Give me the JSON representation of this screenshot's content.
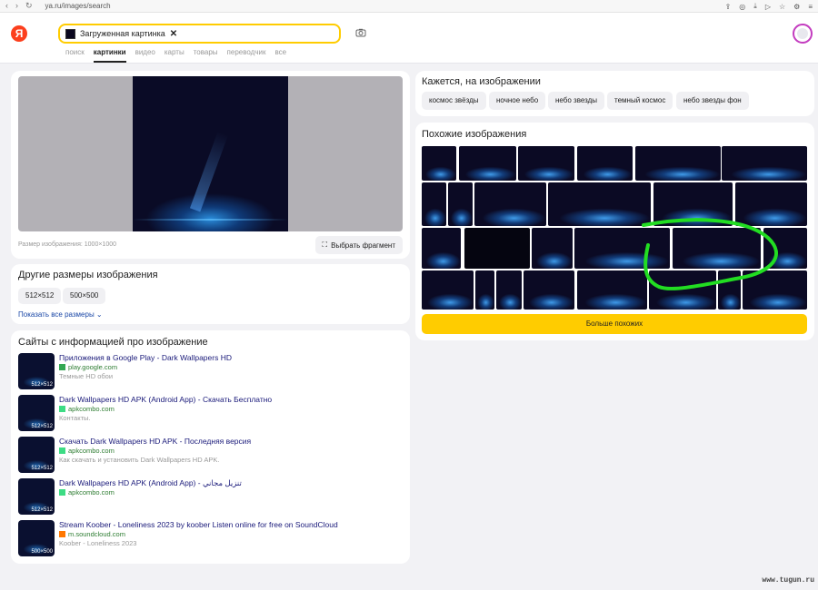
{
  "browser": {
    "url": "ya.ru/images/search"
  },
  "header": {
    "logo": "Я",
    "search_chip": "Загруженная картинка",
    "chip_close": "✕",
    "tabs": [
      "поиск",
      "картинки",
      "видео",
      "карты",
      "товары",
      "переводчик",
      "все"
    ],
    "active_tab": "картинки"
  },
  "preview": {
    "size_label": "Размер изображения: 1000×1000",
    "fragment_button": "Выбрать фрагмент"
  },
  "other_sizes": {
    "title": "Другие размеры изображения",
    "sizes": [
      "512×512",
      "500×500"
    ],
    "show_all": "Показать все размеры"
  },
  "sites": {
    "title": "Сайты с информацией про изображение",
    "items": [
      {
        "title": "Приложения в Google Play - Dark Wallpapers HD",
        "domain": "play.google.com",
        "desc": "Темные HD обои",
        "dim": "512×512",
        "fav_color": "#34a853"
      },
      {
        "title": "Dark Wallpapers HD APK (Android App) - Скачать Бесплатно",
        "domain": "apkcombo.com",
        "desc": "Контакты.",
        "dim": "512×512",
        "fav_color": "#3ddc84"
      },
      {
        "title": "Скачать Dark Wallpapers HD APK - Последняя версия",
        "domain": "apkcombo.com",
        "desc": "Как скачать и установить Dark Wallpapers HD APK.",
        "dim": "512×512",
        "fav_color": "#3ddc84"
      },
      {
        "title": "Dark Wallpapers HD APK (Android App) - تنزيل مجاني",
        "domain": "apkcombo.com",
        "desc": "",
        "dim": "512×512",
        "fav_color": "#3ddc84"
      },
      {
        "title": "Stream Koober - Loneliness 2023 by koober Listen online for free on SoundCloud",
        "domain": "m.soundcloud.com",
        "desc": "Koober - Loneliness 2023",
        "dim": "500×500",
        "fav_color": "#ff7700"
      }
    ]
  },
  "seems": {
    "title": "Кажется, на изображении",
    "tags": [
      "космос звёзды",
      "ночное небо",
      "небо звезды",
      "темный космос",
      "небо звезды фон"
    ]
  },
  "similar": {
    "title": "Похожие изображения",
    "more_button": "Больше похожих"
  },
  "annotation": {
    "color": "#22dd22"
  },
  "watermark": "www.tugun.ru"
}
